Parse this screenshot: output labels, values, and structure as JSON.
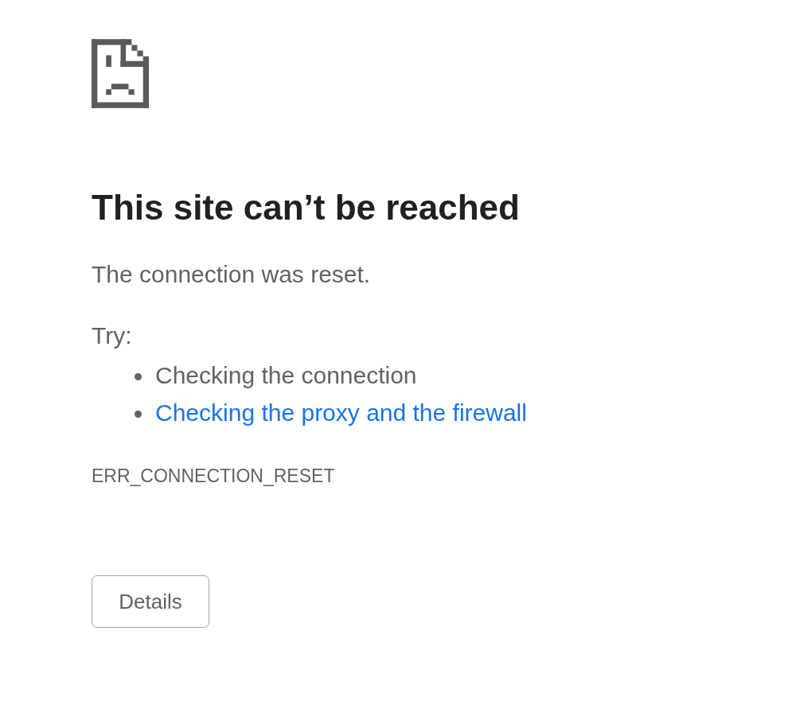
{
  "heading": "This site can’t be reached",
  "message": "The connection was reset.",
  "suggestions": {
    "label": "Try:",
    "items": [
      {
        "text": "Checking the connection",
        "kind": "text"
      },
      {
        "text": "Checking the proxy and the firewall",
        "kind": "link"
      }
    ]
  },
  "error_code": "ERR_CONNECTION_RESET",
  "buttons": [
    {
      "label": "Details"
    }
  ]
}
